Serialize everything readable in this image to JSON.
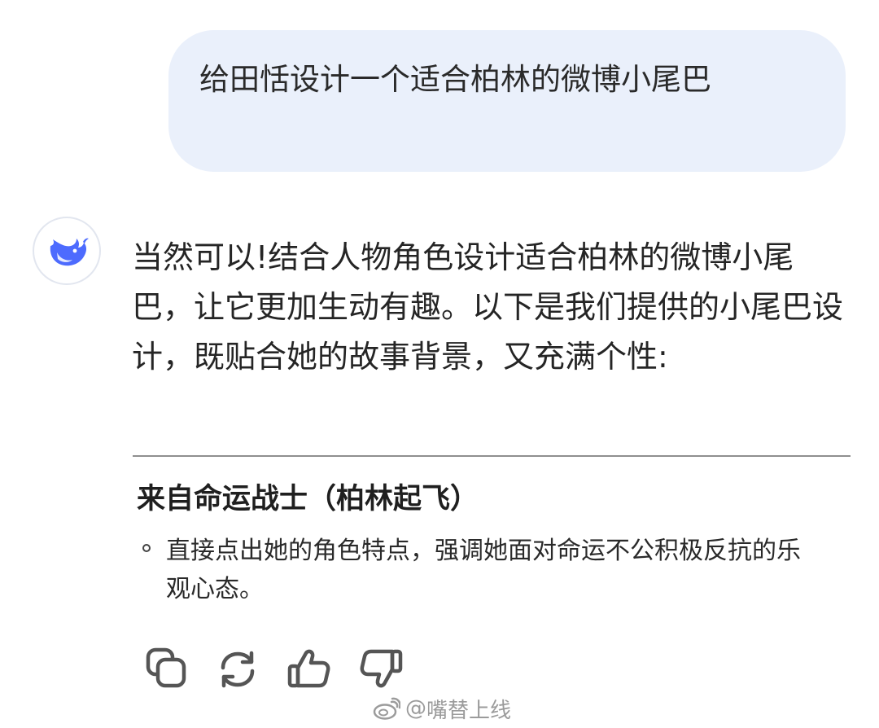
{
  "conversation": {
    "user_message": "给田恬设计一个适合柏林的微博小尾巴",
    "assistant_reply": "当然可以!结合人物角色设计适合柏林的微博小尾巴，让它更加生动有趣。以下是我们提供的小尾巴设计，既贴合她的故事背景，又充满个性:",
    "section_title": "来自命运战士（柏林起飞）",
    "bullet_text": "直接点出她的角色特点，强调她面对命运不公积极反抗的乐观心态。"
  },
  "assistant": {
    "avatar_icon": "whale-logo-icon",
    "brand_color": "#4d6bfe"
  },
  "actions": [
    {
      "name": "copy",
      "icon": "copy-icon"
    },
    {
      "name": "regenerate",
      "icon": "refresh-icon"
    },
    {
      "name": "like",
      "icon": "thumbs-up-icon"
    },
    {
      "name": "dislike",
      "icon": "thumbs-down-icon"
    }
  ],
  "watermark": {
    "at": "@",
    "handle": "嘴替上线"
  },
  "colors": {
    "user_bubble": "#eaf0fb",
    "text": "#222222",
    "icon": "#555555"
  }
}
